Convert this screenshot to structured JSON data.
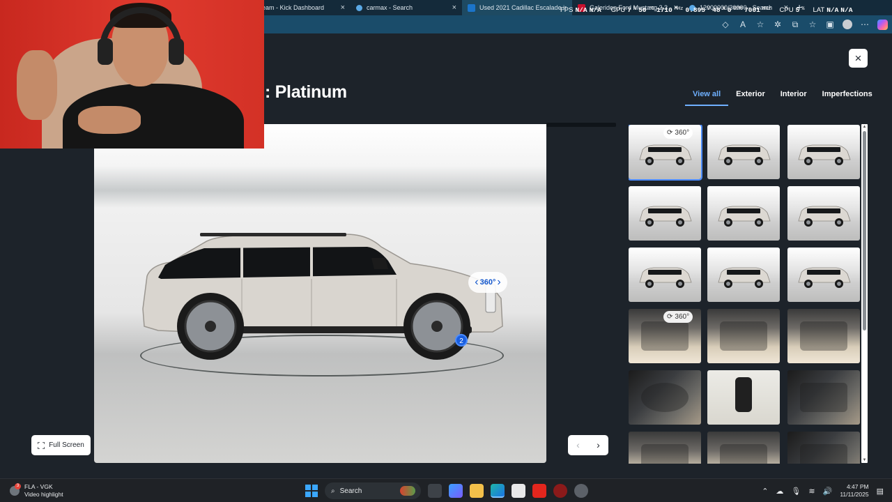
{
  "browser": {
    "tabs": [
      {
        "label": "eam - Kick Dashboard",
        "color": "#53fc18",
        "active": false
      },
      {
        "label": "carmax - Search",
        "color": "#5aa9e6",
        "active": false
      },
      {
        "label": "Used 2021 Cadillac Escalade in G",
        "color": "#1b74c9",
        "active": true
      },
      {
        "label": "Galeriden Ford Mustang 2.3 Fastb",
        "color": "#c8102e",
        "active": false
      },
      {
        "label": "12000000/30000 - Search",
        "color": "#5aa9e6",
        "active": false
      }
    ],
    "new_tab": "+"
  },
  "perf_overlay": {
    "fps_label": "FPS",
    "fps_a": "N/A",
    "fps_b": "N/A",
    "gpu_label": "GPU",
    "gpu_util": "7",
    "gpu_util_unit": "%",
    "gpu_temp": "50",
    "gpu_temp_unit": "°C",
    "gpu_clock": "1710",
    "gpu_clock_unit": "MHz",
    "gpu_volt": "0.895",
    "gpu_volt_unit": "V",
    "gpu_power": "48",
    "gpu_power_unit": "W",
    "fan": "0",
    "fan_unit": "RPM",
    "mem_clock": "7001",
    "mem_clock_unit": "MHz",
    "cpu_label": "CPU",
    "cpu_util": "5",
    "cpu_util_unit": "%",
    "lat_label": "LAT",
    "lat_a": "N/A",
    "lat_b": "N/A"
  },
  "gallery": {
    "title": ": Platinum",
    "close_icon": "×",
    "filters": [
      {
        "label": "View all",
        "active": true
      },
      {
        "label": "Exterior",
        "active": false
      },
      {
        "label": "Interior",
        "active": false
      },
      {
        "label": "Imperfections",
        "active": false
      }
    ],
    "spin_label": "360°",
    "hotspot_number": "2",
    "fullscreen_label": "Full Screen",
    "thumb_badge": "360°",
    "thumbnails": [
      {
        "kind": "studio",
        "view": "front-3q",
        "badge": true,
        "selected": true
      },
      {
        "kind": "studio",
        "view": "front-3q",
        "badge": false,
        "selected": false
      },
      {
        "kind": "studio",
        "view": "front",
        "badge": false,
        "selected": false
      },
      {
        "kind": "studio",
        "view": "front-3q-left",
        "badge": false,
        "selected": false
      },
      {
        "kind": "studio",
        "view": "side",
        "badge": false,
        "selected": false
      },
      {
        "kind": "studio",
        "view": "rear-3q",
        "badge": false,
        "selected": false
      },
      {
        "kind": "studio",
        "view": "rear",
        "badge": false,
        "selected": false
      },
      {
        "kind": "studio",
        "view": "rear-3q",
        "badge": false,
        "selected": false
      },
      {
        "kind": "studio",
        "view": "side",
        "badge": false,
        "selected": false
      },
      {
        "kind": "interior",
        "view": "cabin",
        "badge": true,
        "selected": false
      },
      {
        "kind": "interior",
        "view": "cabin",
        "badge": false,
        "selected": false
      },
      {
        "kind": "interior",
        "view": "seats",
        "badge": false,
        "selected": false
      },
      {
        "kind": "dash",
        "view": "steering",
        "badge": false,
        "selected": false
      },
      {
        "kind": "key",
        "view": "key",
        "badge": false,
        "selected": false
      },
      {
        "kind": "dash",
        "view": "screen",
        "badge": false,
        "selected": false
      },
      {
        "kind": "interior",
        "view": "rear-seats",
        "badge": false,
        "selected": false
      },
      {
        "kind": "interior",
        "view": "roof",
        "badge": false,
        "selected": false
      },
      {
        "kind": "dash",
        "view": "screen",
        "badge": false,
        "selected": false
      }
    ]
  },
  "taskbar": {
    "notif_badge": "3",
    "notif_title": "FLA - VGK",
    "notif_subtitle": "Video highlight",
    "search_label": "Search",
    "time": "4:47 PM",
    "date": "11/11/2025"
  },
  "colors": {
    "accent": "#6fb0ff",
    "page_bg": "#1d232a",
    "hotspot": "#1a5fe0"
  }
}
